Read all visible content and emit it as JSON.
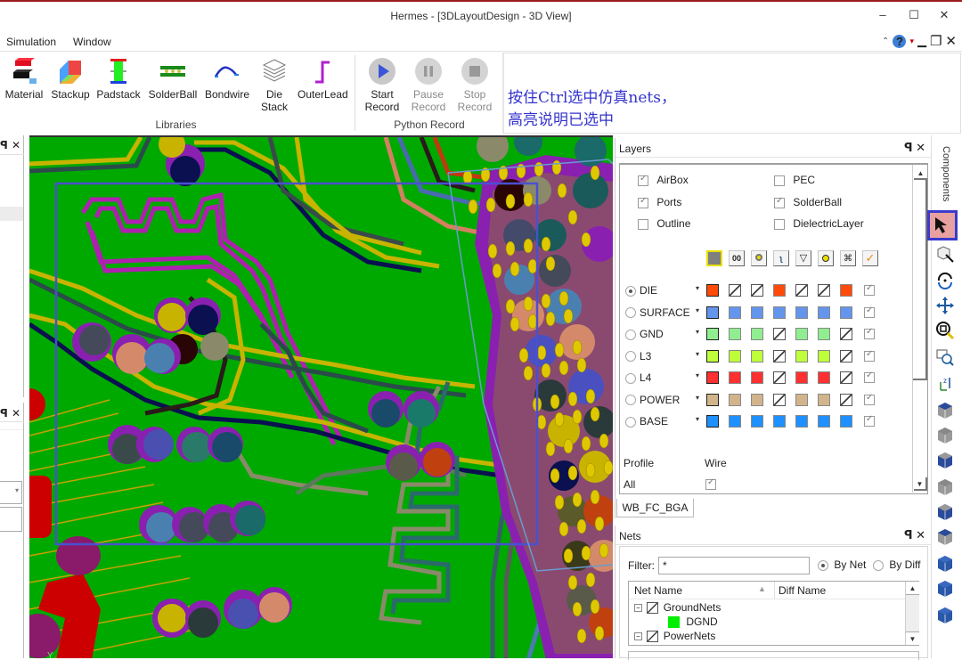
{
  "window": {
    "title": "Hermes - [3DLayoutDesign - 3D View]",
    "minimize": "–",
    "maximize": "☐",
    "close": "✕"
  },
  "menu": {
    "items": [
      "Simulation",
      "Window"
    ],
    "right_controls": {
      "collapse": "⌃",
      "help": "?",
      "help_dropdown": "▾",
      "min": "▁",
      "restore": "❐",
      "close": "✕"
    }
  },
  "ribbon": {
    "libraries": {
      "label": "Libraries",
      "buttons": [
        {
          "label": "Material",
          "icon": "material-icon"
        },
        {
          "label": "Stackup",
          "icon": "stackup-icon"
        },
        {
          "label": "Padstack",
          "icon": "padstack-icon"
        },
        {
          "label": "SolderBall",
          "icon": "solderball-icon"
        },
        {
          "label": "Bondwire",
          "icon": "bondwire-icon"
        },
        {
          "label": "Die\nStack",
          "line1": "Die",
          "line2": "Stack",
          "icon": "die-stack-icon"
        },
        {
          "label": "OuterLead",
          "icon": "outerlead-icon"
        }
      ]
    },
    "python_record": {
      "label": "Python Record",
      "buttons": [
        {
          "line1": "Start",
          "line2": "Record",
          "icon": "play-icon",
          "enabled": true
        },
        {
          "line1": "Pause",
          "line2": "Record",
          "icon": "pause-icon",
          "enabled": false
        },
        {
          "line1": "Stop",
          "line2": "Record",
          "icon": "stop-icon",
          "enabled": false
        }
      ]
    }
  },
  "annotation": {
    "line1": "按住Ctrl选中仿真nets，",
    "line2": "高亮说明已选中",
    "color": "#3333cc"
  },
  "left_docks": {
    "pin": "ꟼ",
    "close": "✕",
    "dropdown_arrow": "▾"
  },
  "layers_panel": {
    "title": "Layers",
    "checkboxes": [
      {
        "label": "AirBox",
        "checked": true
      },
      {
        "label": "PEC",
        "checked": false
      },
      {
        "label": "Ports",
        "checked": true
      },
      {
        "label": "SolderBall",
        "checked": true
      },
      {
        "label": "Outline",
        "checked": false
      },
      {
        "label": "DielectricLayer",
        "checked": false
      }
    ],
    "column_icons": [
      "layer-color-icon",
      "trace-icon",
      "via-icon",
      "bondwire-icon",
      "pad-icon",
      "solderball-icon",
      "component-icon",
      "visible-check-icon"
    ],
    "layers": [
      {
        "name": "DIE",
        "selected": true,
        "color": "#ff4a0a",
        "swatches": [
          "color",
          "hatch",
          "hatch",
          "color",
          "hatch",
          "hatch",
          "color"
        ],
        "visible": true
      },
      {
        "name": "SURFACE",
        "selected": false,
        "color": "#6495ed",
        "swatches": [
          "color",
          "color",
          "color",
          "color",
          "color",
          "color",
          "color"
        ],
        "visible": true
      },
      {
        "name": "GND",
        "selected": false,
        "color": "#90ee90",
        "swatches": [
          "color",
          "color",
          "color",
          "hatch",
          "color",
          "color",
          "hatch"
        ],
        "visible": true
      },
      {
        "name": "L3",
        "selected": false,
        "color": "#bfff3a",
        "swatches": [
          "color",
          "color",
          "color",
          "hatch",
          "color",
          "color",
          "hatch"
        ],
        "visible": true
      },
      {
        "name": "L4",
        "selected": false,
        "color": "#ff3030",
        "swatches": [
          "color",
          "color",
          "color",
          "hatch",
          "color",
          "color",
          "hatch"
        ],
        "visible": true
      },
      {
        "name": "POWER",
        "selected": false,
        "color": "#d2b48c",
        "swatches": [
          "color",
          "color",
          "color",
          "hatch",
          "color",
          "color",
          "hatch"
        ],
        "visible": true
      },
      {
        "name": "BASE",
        "selected": false,
        "color": "#1e90ff",
        "swatches": [
          "color",
          "color",
          "color",
          "color",
          "color",
          "color",
          "color"
        ],
        "visible": true
      }
    ],
    "profile": {
      "header_profile": "Profile",
      "header_wire": "Wire",
      "row_label": "All",
      "wire_checked": true
    },
    "tab": "WB_FC_BGA"
  },
  "nets_panel": {
    "title": "Nets",
    "filter_label": "Filter:",
    "filter_value": "*",
    "by_net": "By Net",
    "by_diff": "By Diff",
    "mode": "By Net",
    "columns": [
      "Net Name",
      "Diff Name"
    ],
    "tree": [
      {
        "label": "GroundNets",
        "type": "group",
        "expanded": true
      },
      {
        "label": "DGND",
        "type": "net",
        "color": "#00ee00"
      },
      {
        "label": "PowerNets",
        "type": "group",
        "expanded": true
      }
    ]
  },
  "right_sidebar": {
    "tab": "Components",
    "tools": [
      "select-arrow-icon",
      "select-3d-icon",
      "rotate-icon",
      "pan-icon",
      "zoom-fit-icon",
      "zoom-window-icon",
      "axis-icon",
      "view-top-icon",
      "view-bottom-icon",
      "view-left-icon",
      "view-right-icon",
      "view-front-icon",
      "view-back-icon",
      "view-iso1-icon",
      "view-iso2-icon",
      "view-iso3-icon"
    ],
    "active_tool": "select-arrow-icon"
  },
  "view3d": {
    "axis_label": "Y"
  }
}
